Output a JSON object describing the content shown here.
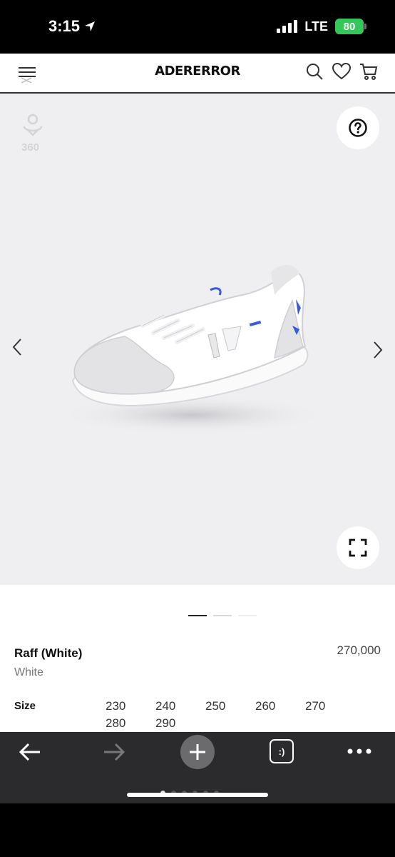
{
  "status_bar": {
    "time": "3:15",
    "network": "LTE",
    "battery": "80"
  },
  "header": {
    "logo": "ADERERROR",
    "icons": [
      "menu-icon",
      "search-icon",
      "heart-icon",
      "cart-icon"
    ]
  },
  "gallery": {
    "badge_text": "360",
    "help_label": "?",
    "icons": [
      "360-icon",
      "question-icon",
      "chevron-left-icon",
      "chevron-right-icon",
      "expand-icon"
    ],
    "active_slide": 1,
    "slide_count": 3
  },
  "product": {
    "name": "Raff (White)",
    "color": "White",
    "price": "270,000",
    "size_label": "Size",
    "sizes": [
      "230",
      "240",
      "250",
      "260",
      "270",
      "280",
      "290"
    ]
  },
  "toolbar": {
    "tabs_label": ":)",
    "icons": [
      "back-arrow-icon",
      "forward-arrow-icon",
      "plus-icon",
      "tabs-icon",
      "more-icon"
    ]
  },
  "colors": {
    "battery": "#34c759",
    "gallery_bg": "#efeff1",
    "toolbar_bg": "#2b2b2d",
    "accent_blue": "#3a5bd9"
  }
}
